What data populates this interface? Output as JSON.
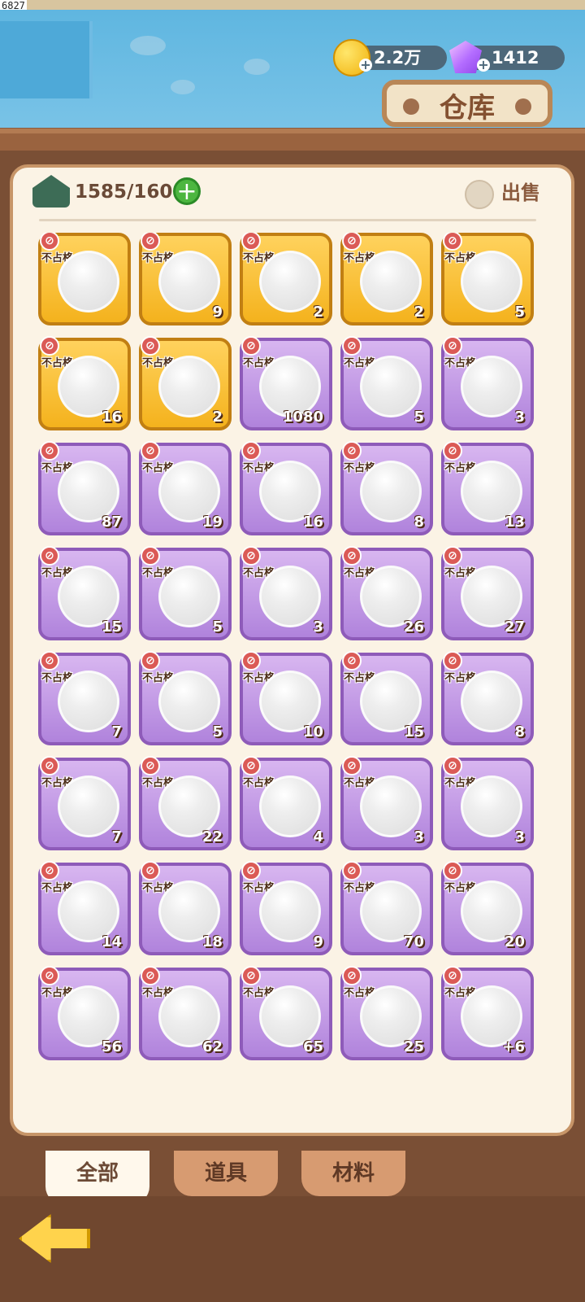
{
  "screen": {
    "title_sign": "仓库",
    "overlay_id": "6827"
  },
  "currencies": {
    "coins": "2.2万",
    "gems": "1412"
  },
  "storage": {
    "capacity": "1585/1600",
    "sell_label": "出售"
  },
  "item_tag": "不占格",
  "items": [
    {
      "count": "",
      "rarity": "gold",
      "icon": "bottle-icon"
    },
    {
      "count": "9",
      "rarity": "gold",
      "icon": "cloud-cat-icon"
    },
    {
      "count": "2",
      "rarity": "gold",
      "icon": "dark-cat-icon"
    },
    {
      "count": "2",
      "rarity": "gold",
      "icon": "pink-cat-icon"
    },
    {
      "count": "5",
      "rarity": "gold",
      "icon": "witch-cat-icon"
    },
    {
      "count": "16",
      "rarity": "gold",
      "icon": "sword-orb-icon"
    },
    {
      "count": "2",
      "rarity": "gold",
      "icon": "hat-orb-icon"
    },
    {
      "count": "1080",
      "rarity": "purple",
      "icon": "star-icon"
    },
    {
      "count": "5",
      "rarity": "purple",
      "icon": "clock-icon"
    },
    {
      "count": "3",
      "rarity": "purple",
      "icon": "crystal-bottle-icon"
    },
    {
      "count": "87",
      "rarity": "purple",
      "icon": "trophy-icon"
    },
    {
      "count": "19",
      "rarity": "purple",
      "icon": "ore-icon"
    },
    {
      "count": "16",
      "rarity": "purple",
      "icon": "gold-ore-icon"
    },
    {
      "count": "8",
      "rarity": "purple",
      "icon": "red-crystal-icon"
    },
    {
      "count": "13",
      "rarity": "purple",
      "icon": "blue-crystal-icon"
    },
    {
      "count": "15",
      "rarity": "purple",
      "icon": "cat-glass-icon"
    },
    {
      "count": "5",
      "rarity": "purple",
      "icon": "biscuit-icon"
    },
    {
      "count": "3",
      "rarity": "purple",
      "icon": "cat-icon"
    },
    {
      "count": "26",
      "rarity": "purple",
      "icon": "green-cat-icon"
    },
    {
      "count": "27",
      "rarity": "purple",
      "icon": "pirate-cat-icon"
    },
    {
      "count": "7",
      "rarity": "purple",
      "icon": "mummy-cat-icon"
    },
    {
      "count": "5",
      "rarity": "purple",
      "icon": "hat-cat-icon"
    },
    {
      "count": "10",
      "rarity": "purple",
      "icon": "white-cat-icon"
    },
    {
      "count": "15",
      "rarity": "purple",
      "icon": "horn-cat-icon"
    },
    {
      "count": "8",
      "rarity": "purple",
      "icon": "feather-cat-icon"
    },
    {
      "count": "7",
      "rarity": "purple",
      "icon": "straw-hat-cat-icon"
    },
    {
      "count": "22",
      "rarity": "purple",
      "icon": "headphone-cat-icon"
    },
    {
      "count": "4",
      "rarity": "purple",
      "icon": "brown-cat-icon"
    },
    {
      "count": "3",
      "rarity": "purple",
      "icon": "fish-bag-icon"
    },
    {
      "count": "3",
      "rarity": "purple",
      "icon": "fish-bag-icon"
    },
    {
      "count": "14",
      "rarity": "purple",
      "icon": "clover-icon"
    },
    {
      "count": "18",
      "rarity": "purple",
      "icon": "horseshoe-icon"
    },
    {
      "count": "9",
      "rarity": "purple",
      "icon": "candle-icon"
    },
    {
      "count": "70",
      "rarity": "purple",
      "icon": "wand-orb-icon"
    },
    {
      "count": "20",
      "rarity": "purple",
      "icon": "arrow-orb-icon"
    },
    {
      "count": "56",
      "rarity": "purple",
      "icon": "graduation-cap-icon"
    },
    {
      "count": "62",
      "rarity": "purple",
      "icon": "branch-orb-icon"
    },
    {
      "count": "65",
      "rarity": "purple",
      "icon": "white-cat-orb-icon"
    },
    {
      "count": "25",
      "rarity": "purple",
      "icon": "key-orb-icon"
    },
    {
      "count": "+6",
      "rarity": "purple",
      "icon": "feather-crystal-icon"
    }
  ],
  "tabs": [
    {
      "label": "全部"
    },
    {
      "label": "道具"
    },
    {
      "label": "材料"
    }
  ]
}
